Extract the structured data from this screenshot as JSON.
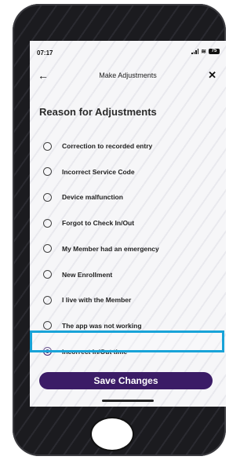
{
  "status_bar": {
    "time": "07:17",
    "battery": "75"
  },
  "header": {
    "back_label": "←",
    "title": "Make Adjustments",
    "close_label": "✕"
  },
  "section": {
    "title": "Reason for Adjustments"
  },
  "options": [
    {
      "label": "Correction to recorded entry",
      "selected": false
    },
    {
      "label": "Incorrect Service Code",
      "selected": false
    },
    {
      "label": "Device malfunction",
      "selected": false
    },
    {
      "label": "Forgot to Check In/Out",
      "selected": false
    },
    {
      "label": "My Member had an emergency",
      "selected": false
    },
    {
      "label": "New Enrollment",
      "selected": false
    },
    {
      "label": "I live with the Member",
      "selected": false
    },
    {
      "label": "The app was not working",
      "selected": false
    },
    {
      "label": "Incorrect In/Out time",
      "selected": true
    }
  ],
  "actions": {
    "save_label": "Save Changes"
  },
  "colors": {
    "accent": "#3b1c66",
    "highlight": "#18a3d8"
  }
}
